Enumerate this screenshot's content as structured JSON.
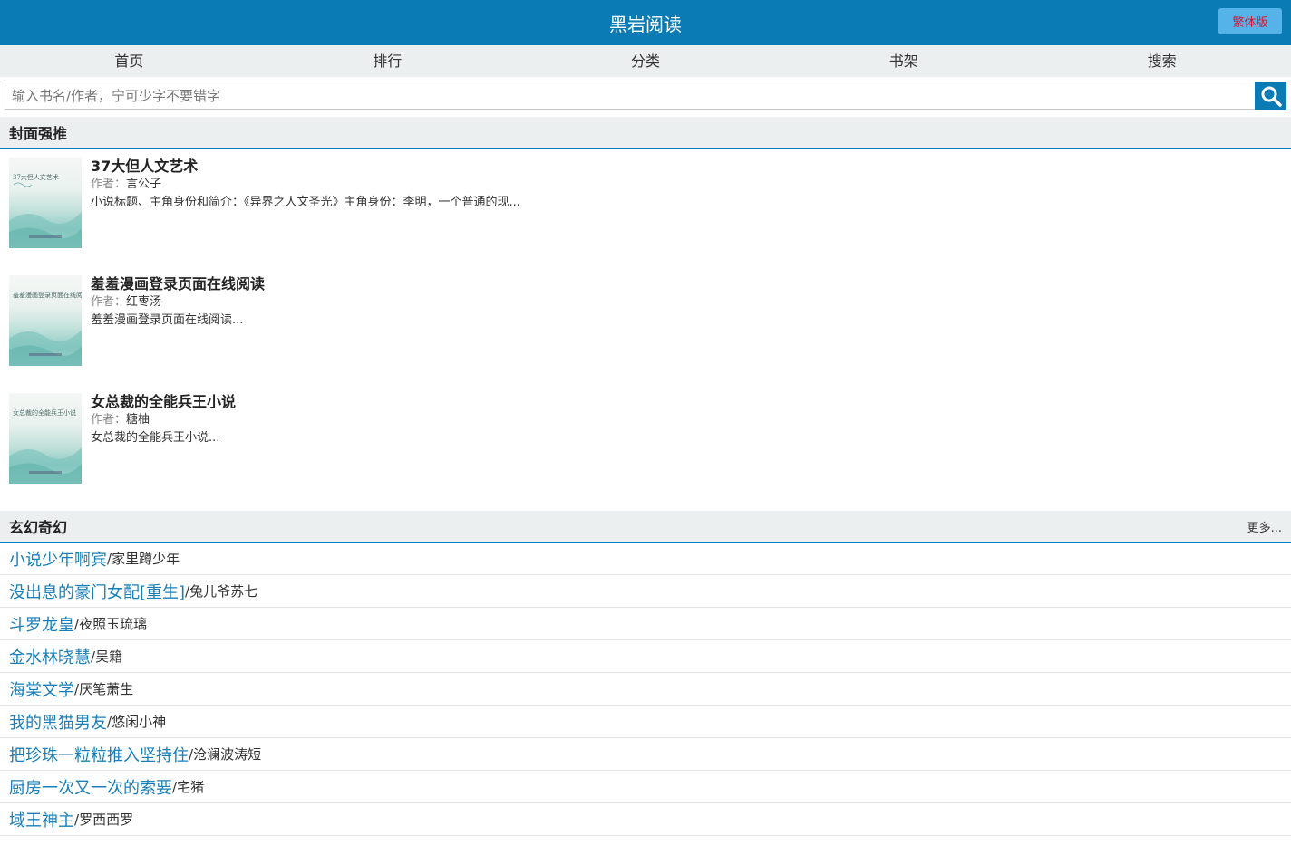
{
  "header": {
    "title": "黑岩阅读",
    "trad_button": "繁体版"
  },
  "nav": [
    "首页",
    "排行",
    "分类",
    "书架",
    "搜索"
  ],
  "search": {
    "placeholder": "输入书名/作者，宁可少字不要错字",
    "value": ""
  },
  "featured": {
    "title": "封面强推",
    "author_label": "作者：",
    "books": [
      {
        "title": "37大但人文艺术",
        "author": "言公子",
        "desc": "小说标题、主角身份和简介：《异界之人文圣光》主角身份：李明，一个普通的现...",
        "cover_text": "37大但人文艺术"
      },
      {
        "title": "羞羞漫画登录页面在线阅读",
        "author": "红枣汤",
        "desc": "羞羞漫画登录页面在线阅读...",
        "cover_text": "羞羞漫画登录页面在线阅读"
      },
      {
        "title": "女总裁的全能兵王小说",
        "author": "糖柚",
        "desc": "女总裁的全能兵王小说...",
        "cover_text": "女总裁的全能兵王小说"
      }
    ]
  },
  "category": {
    "title": "玄幻奇幻",
    "more": "更多...",
    "separator": "/",
    "items": [
      {
        "title": "小说少年啊宾",
        "author": "家里蹲少年"
      },
      {
        "title": "没出息的豪门女配[重生]",
        "author": "兔儿爷苏七"
      },
      {
        "title": "斗罗龙皇",
        "author": "夜照玉琉璃"
      },
      {
        "title": "金水林晓慧",
        "author": "吴籍"
      },
      {
        "title": "海棠文学",
        "author": "厌笔萧生"
      },
      {
        "title": "我的黑猫男友",
        "author": "悠闲小神"
      },
      {
        "title": "把珍珠一粒粒推入坚持住",
        "author": "沧澜波涛短"
      },
      {
        "title": "厨房一次又一次的索要",
        "author": "宅猪"
      },
      {
        "title": "域王神主",
        "author": "罗西西罗"
      }
    ]
  },
  "colors": {
    "primary": "#0a7bb5",
    "link": "#1a7fb8",
    "trad_text": "#e0102a",
    "section_bg": "#eceff0"
  }
}
